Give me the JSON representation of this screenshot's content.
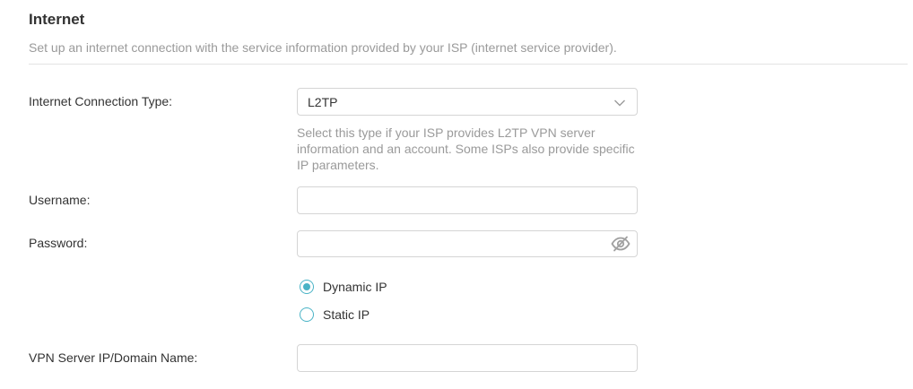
{
  "header": {
    "title": "Internet",
    "description": "Set up an internet connection with the service information provided by your ISP (internet service provider)."
  },
  "connection_type": {
    "label": "Internet Connection Type:",
    "value": "L2TP",
    "hint": "Select this type if your ISP provides L2TP VPN server information and an account. Some ISPs also provide specific IP parameters."
  },
  "username": {
    "label": "Username:",
    "value": ""
  },
  "password": {
    "label": "Password:",
    "value": ""
  },
  "ip_mode": {
    "options": [
      {
        "label": "Dynamic IP",
        "checked": true
      },
      {
        "label": "Static IP",
        "checked": false
      }
    ]
  },
  "vpn_server": {
    "label": "VPN Server IP/Domain Name:",
    "value": ""
  },
  "colors": {
    "accent": "#4ab3c6",
    "border": "#d5d5d5",
    "muted_text": "#9a9a9a"
  },
  "icons": {
    "select_arrow": "chevron-down-icon",
    "password_toggle": "eye-off-icon"
  }
}
